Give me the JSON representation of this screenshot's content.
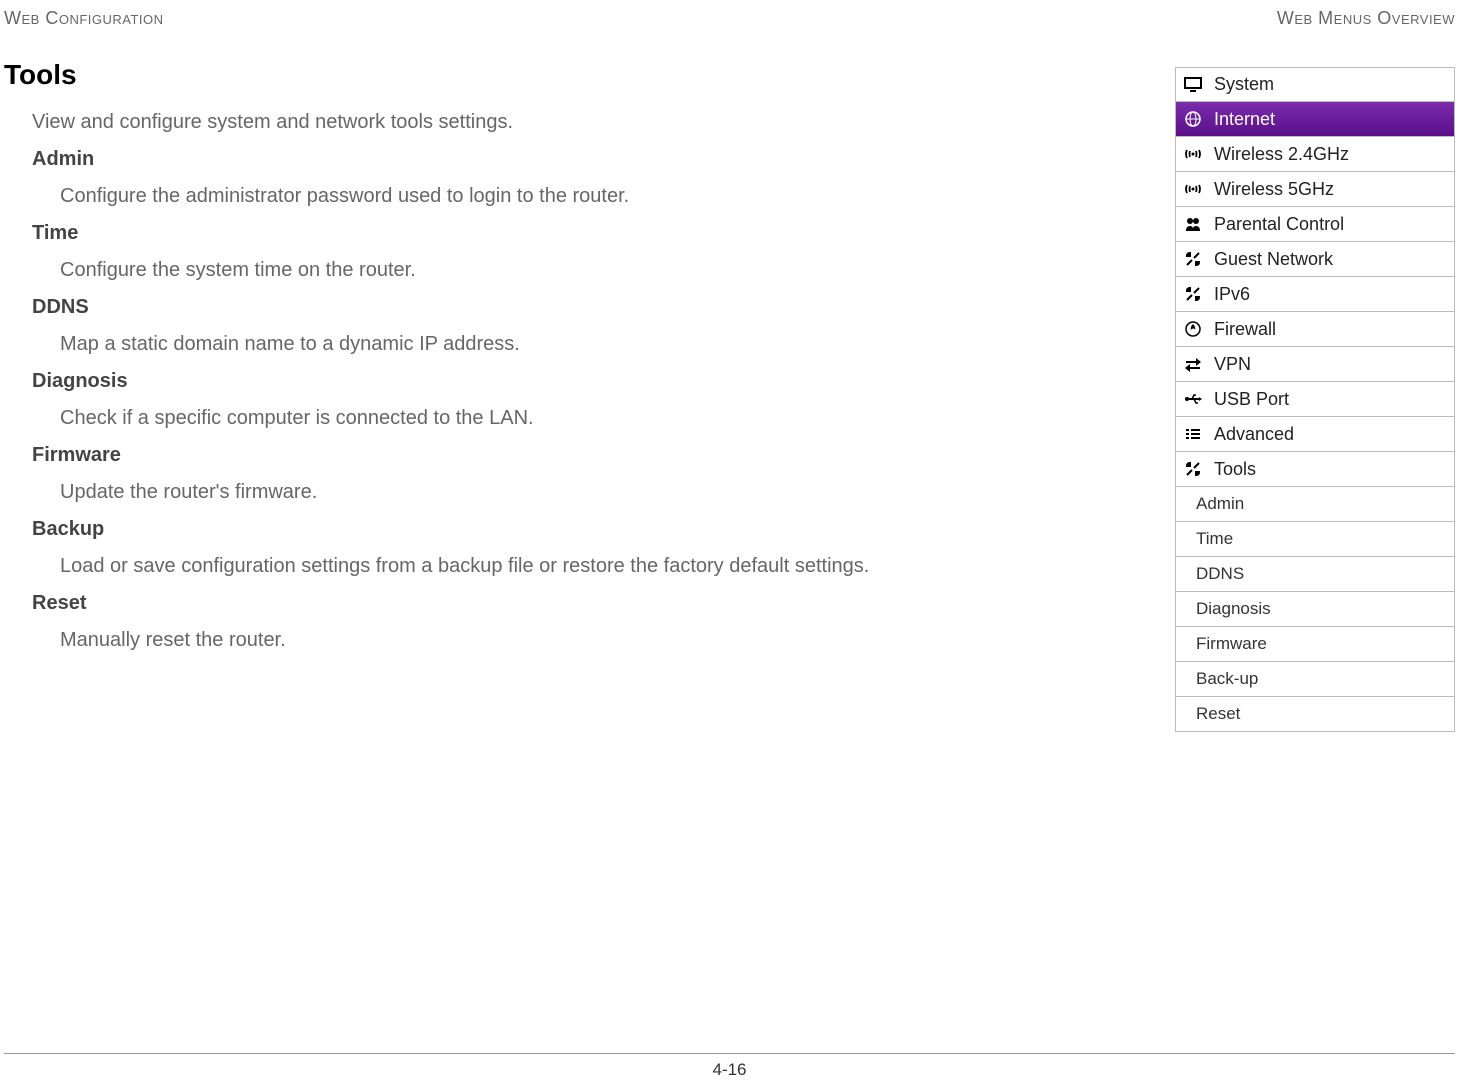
{
  "header": {
    "left": "Web Configuration",
    "right": "Web Menus Overview"
  },
  "section": {
    "title": "Tools",
    "intro": "View and configure system and network tools settings.",
    "items": [
      {
        "title": "Admin",
        "desc": "Configure the administrator password used to login to the router."
      },
      {
        "title": "Time",
        "desc": "Configure the system time on the router."
      },
      {
        "title": "DDNS",
        "desc": "Map a static domain name to a dynamic IP address."
      },
      {
        "title": "Diagnosis",
        "desc": "Check if a specific computer is connected to the LAN."
      },
      {
        "title": "Firmware",
        "desc": "Update the router's firmware."
      },
      {
        "title": "Backup",
        "desc": "Load or save configuration settings from a backup file or restore the factory default settings."
      },
      {
        "title": "Reset",
        "desc": "Manually reset the router."
      }
    ]
  },
  "menu": {
    "main": [
      {
        "label": "System",
        "icon": "monitor"
      },
      {
        "label": "Internet",
        "icon": "globe",
        "selected": true
      },
      {
        "label": "Wireless 2.4GHz",
        "icon": "signal"
      },
      {
        "label": "Wireless 5GHz",
        "icon": "signal"
      },
      {
        "label": "Parental Control",
        "icon": "people"
      },
      {
        "label": "Guest Network",
        "icon": "tools"
      },
      {
        "label": "IPv6",
        "icon": "tools"
      },
      {
        "label": "Firewall",
        "icon": "fire"
      },
      {
        "label": "VPN",
        "icon": "arrows"
      },
      {
        "label": "USB Port",
        "icon": "usb"
      },
      {
        "label": "Advanced",
        "icon": "list"
      },
      {
        "label": "Tools",
        "icon": "tools"
      }
    ],
    "sub": [
      {
        "label": "Admin"
      },
      {
        "label": "Time"
      },
      {
        "label": "DDNS"
      },
      {
        "label": "Diagnosis"
      },
      {
        "label": "Firmware"
      },
      {
        "label": "Back-up"
      },
      {
        "label": "Reset"
      }
    ]
  },
  "footer": {
    "page": "4-16"
  }
}
